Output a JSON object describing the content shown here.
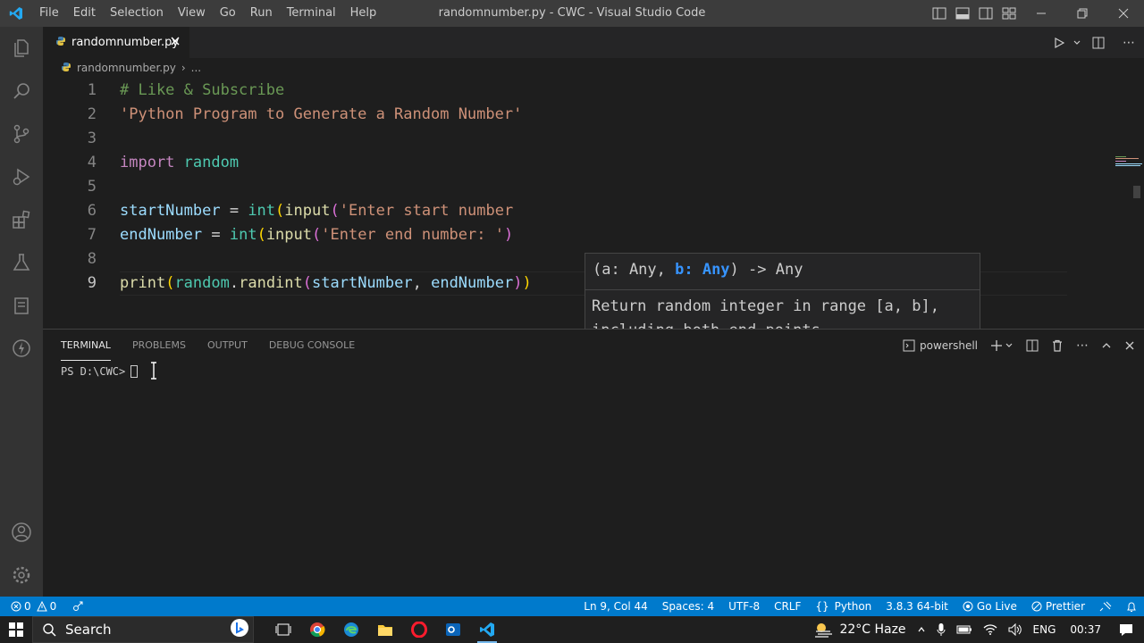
{
  "window": {
    "title": "randomnumber.py - CWC - Visual Studio Code",
    "menu": [
      "File",
      "Edit",
      "Selection",
      "View",
      "Go",
      "Run",
      "Terminal",
      "Help"
    ]
  },
  "tab": {
    "label": "randomnumber.py"
  },
  "breadcrumb": {
    "file": "randomnumber.py",
    "more": "..."
  },
  "editor": {
    "line_numbers": [
      "1",
      "2",
      "3",
      "4",
      "5",
      "6",
      "7",
      "8",
      "9"
    ],
    "l1": "# Like & Subscribe",
    "l2": "'Python Program to Generate a Random Number'",
    "l4_kw": "import",
    "l4_mod": "random",
    "l6_var": "startNumber",
    "l6_eq": " = ",
    "l6_int": "int",
    "l6_p1": "(",
    "l6_input": "input",
    "l6_p2": "(",
    "l6_str": "'Enter start number",
    "l7_var": "endNumber",
    "l7_eq": " = ",
    "l7_int": "int",
    "l7_p1": "(",
    "l7_input": "input",
    "l7_p2": "(",
    "l7_str": "'Enter end number: '",
    "l7_p3": ")",
    "l9_print": "print",
    "l9_p1": "(",
    "l9_mod": "random",
    "l9_dot": ".",
    "l9_fn": "randint",
    "l9_p2": "(",
    "l9_arg1": "startNumber",
    "l9_comma": ", ",
    "l9_arg2": "endNumber",
    "l9_p3": ")",
    "l9_p4": ")"
  },
  "hover": {
    "sig_pre": "(a: Any, ",
    "sig_hl": "b: Any",
    "sig_post": ") -> Any",
    "doc": "Return random integer in range [a, b], including both end points."
  },
  "panel": {
    "tabs": [
      "TERMINAL",
      "PROBLEMS",
      "OUTPUT",
      "DEBUG CONSOLE"
    ],
    "shell": "powershell",
    "prompt": "PS D:\\CWC>"
  },
  "status": {
    "errors": "0",
    "warnings": "0",
    "position": "Ln 9, Col 44",
    "spaces": "Spaces: 4",
    "encoding": "UTF-8",
    "eol": "CRLF",
    "language": "Python",
    "interpreter": "3.8.3 64-bit",
    "golive": "Go Live",
    "prettier": "Prettier"
  },
  "taskbar": {
    "search": "Search",
    "weather": "22°C Haze",
    "lang": "ENG",
    "time": "00:37"
  },
  "colors": {
    "accent": "#007acc",
    "titlebar": "#3c3c3c",
    "activitybar": "#333333",
    "editor": "#1e1e1e"
  }
}
